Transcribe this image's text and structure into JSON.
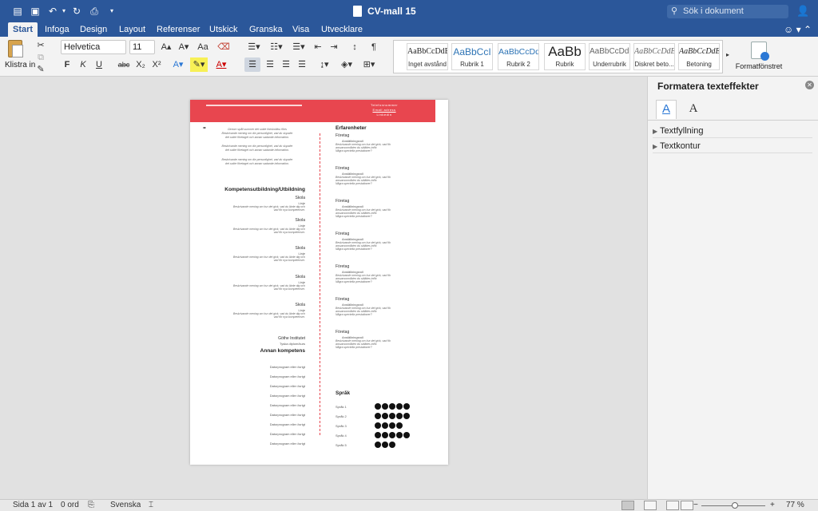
{
  "titlebar": {
    "title": "CV-mall 15",
    "search_placeholder": "Sök i dokument"
  },
  "tabs": [
    "Start",
    "Infoga",
    "Design",
    "Layout",
    "Referenser",
    "Utskick",
    "Granska",
    "Visa",
    "Utvecklare"
  ],
  "active_tab": "Start",
  "ribbon": {
    "paste_label": "Klistra in",
    "font_name": "Helvetica",
    "font_size": "11",
    "bold": "F",
    "italic": "K",
    "underline": "U",
    "strike": "abc",
    "subscript": "X₂",
    "superscript": "X²",
    "styles": [
      {
        "preview": "AaBbCcDdEe",
        "name": "Inget avstånd"
      },
      {
        "preview": "AaBbCcI",
        "name": "Rubrik 1"
      },
      {
        "preview": "AaBbCcDd",
        "name": "Rubrik 2"
      },
      {
        "preview": "AaBb",
        "name": "Rubrik"
      },
      {
        "preview": "AaBbCcDdI",
        "name": "Underrubrik"
      },
      {
        "preview": "AaBbCcDdEe",
        "name": "Diskret beto..."
      },
      {
        "preview": "AaBbCcDdEe",
        "name": "Betoning"
      }
    ],
    "format_pane_label": "Formatfönstret"
  },
  "side_pane": {
    "title": "Formatera texteffekter",
    "sections": [
      "Textfyllning",
      "Textkontur"
    ]
  },
  "document": {
    "header_contact": [
      "Telefonnummer",
      "Email adress",
      "Linkedin"
    ],
    "quote_lines": [
      "Genom spåll summer det sokte fortskoltlou förts",
      "Beskrivande mening om din personlighet, vad du skyuder",
      "det sokte företaget och annan sadande information.",
      "Beskrivande mening om din personlighet, vad du skyuder",
      "det sokte företaget och annan sadande information.",
      "Beskrivande mening om din personlighet, vad du skyuder",
      "det sokte företaget och annan sadande information."
    ],
    "education_heading": "Kompetensutbildning/Utbildning",
    "school_label": "Skola",
    "line_label": "Linje",
    "school_desc_1": "Beskrivande mening om hur det gick, vad du lärde dig och",
    "school_desc_2": "vad för nya kompetenser.",
    "goethe_label": "Göthe Institutet",
    "goethe_sub": "Tyska diplom/kurs",
    "other_heading": "Annan kompetens",
    "other_item": "Datorprogram eller övrigt",
    "experience_heading": "Erfarenheter",
    "company_label": "Företag",
    "role_label": "Anställningsroll",
    "role_desc_1": "Beskrivande mening om hur det gick, vad för",
    "role_desc_2": "ansvarsområden du ställdes inför.",
    "role_desc_3": "Några speciella prestationer?",
    "lang_heading": "Språk",
    "languages": [
      {
        "name": "Språk 1",
        "level": 5
      },
      {
        "name": "Språk 2",
        "level": 5
      },
      {
        "name": "Språk 3",
        "level": 4
      },
      {
        "name": "Språk 4",
        "level": 5
      },
      {
        "name": "Språk 5",
        "level": 3
      }
    ]
  },
  "status": {
    "page": "Sida 1 av 1",
    "words": "0 ord",
    "language": "Svenska",
    "zoom": "77 %"
  },
  "colors": {
    "accent": "#2b579a",
    "header_red": "#e8464f"
  }
}
